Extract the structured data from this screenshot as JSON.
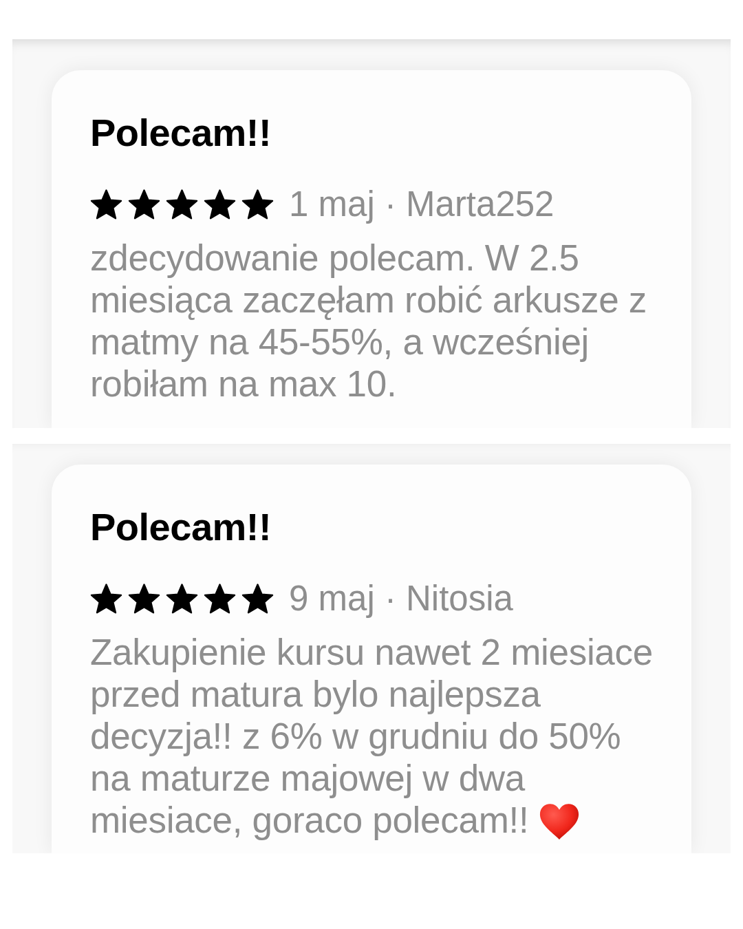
{
  "reviews": [
    {
      "title": "Polecam!!",
      "stars": 5,
      "byline": "1 maj · Marta252",
      "body": "zdecydowanie polecam. W 2.5 miesiąca zaczęłam robić arkusze z matmy na 45-55%, a wcześniej robiłam na max 10.",
      "trailing_emoji": false
    },
    {
      "title": "Polecam!!",
      "stars": 5,
      "byline": "9 maj · Nitosia",
      "body": "Zakupienie kursu nawet 2 miesiace przed matura bylo najlepsza decyzja!! z 6% w grudniu do 50% na maturze majowej w dwa miesiace, goraco polecam!!",
      "trailing_emoji": true
    }
  ]
}
